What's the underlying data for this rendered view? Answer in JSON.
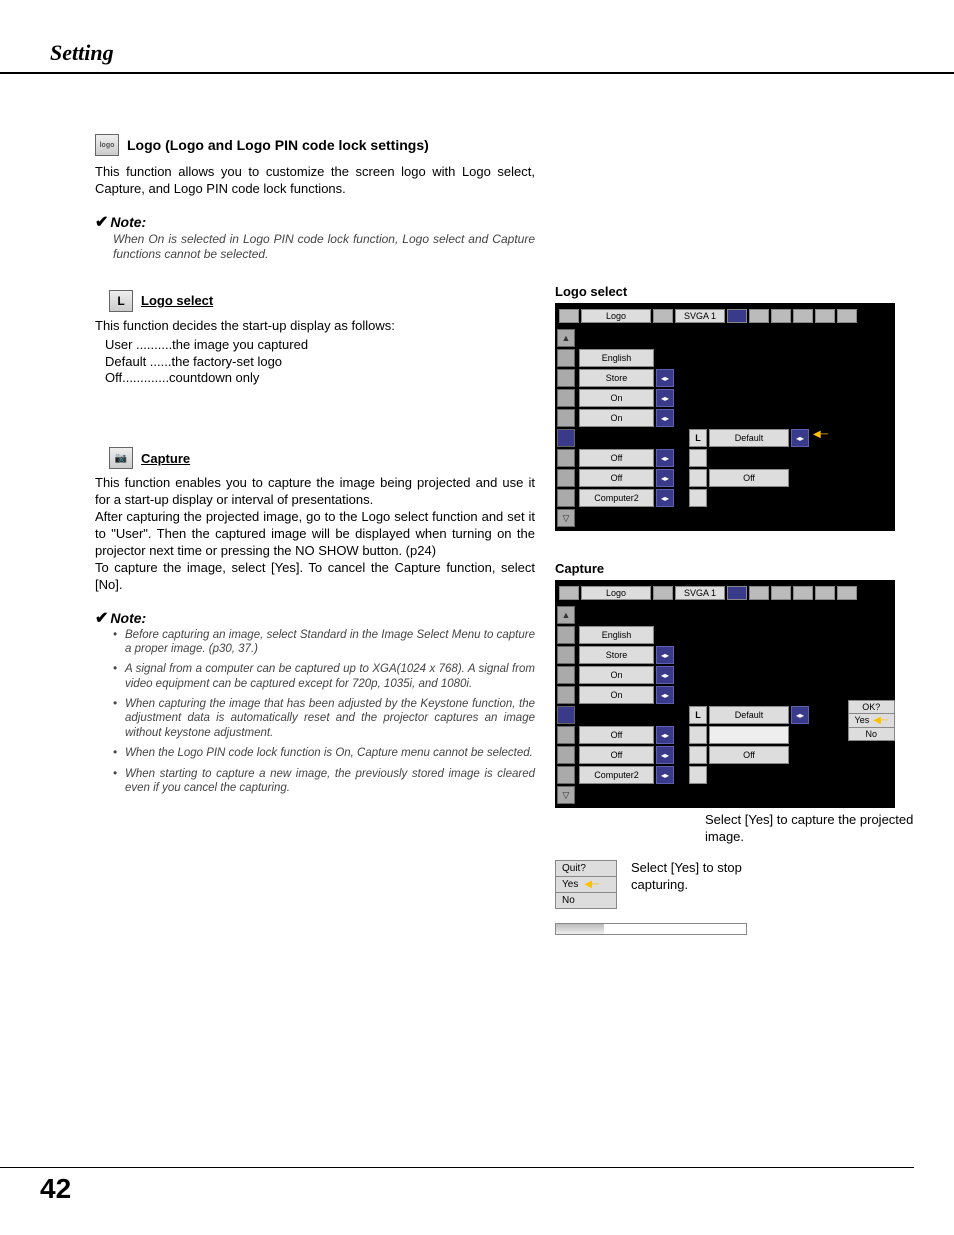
{
  "header": {
    "title": "Setting"
  },
  "logo_section": {
    "heading": "Logo (Logo and Logo PIN code lock settings)",
    "body": "This function allows you to customize the screen logo with Logo select, Capture, and Logo PIN code lock functions."
  },
  "note1": {
    "label": "Note:",
    "text": "When On is selected in Logo PIN code lock function, Logo select and Capture functions cannot be selected."
  },
  "logo_select": {
    "heading": "Logo select",
    "intro": "This function decides the start-up display as follows:",
    "opt_user": "User ..........the image you captured",
    "opt_default": "Default ......the factory-set logo",
    "opt_off": "Off.............countdown only"
  },
  "capture": {
    "heading": "Capture",
    "p1": "This function enables you to capture the image being projected and use it for a start-up display or interval of presentations.",
    "p2": "After capturing the projected image, go to the Logo select function and set it to \"User\".  Then the captured image will be displayed when turning on the projector next time or pressing the NO SHOW button.  (p24)",
    "p3": "To capture the image, select [Yes].  To cancel the Capture function, select [No]."
  },
  "note2": {
    "label": "Note:",
    "items": [
      "Before capturing an image, select Standard in the Image Select Menu to capture a proper image.  (p30, 37.)",
      "A signal from a computer can be captured up to XGA(1024 x 768).  A signal from video equipment can be captured except for 720p, 1035i, and 1080i.",
      "When capturing the image that has been adjusted by the Keystone function, the adjustment data is automatically reset and the projector captures an image without keystone adjustment.",
      "When the Logo PIN code lock function is On, Capture menu cannot be selected.",
      "When starting to capture a new image, the previously stored image is cleared even if you cancel the capturing."
    ]
  },
  "right": {
    "logo_title": "Logo select",
    "capture_title": "Capture",
    "caption1": "Select [Yes] to capture the projected image.",
    "caption2": "Select [Yes] to stop capturing.",
    "menu": {
      "tab_label": "Logo",
      "svga": "SVGA 1",
      "rows": [
        "English",
        "Store",
        "On",
        "On",
        "Off",
        "Off",
        "Computer2"
      ],
      "sub": {
        "default": "Default",
        "off": "Off"
      },
      "ok": {
        "q": "OK?",
        "yes": "Yes",
        "no": "No"
      },
      "quit": {
        "q": "Quit?",
        "yes": "Yes",
        "no": "No"
      }
    }
  },
  "page_number": "42"
}
